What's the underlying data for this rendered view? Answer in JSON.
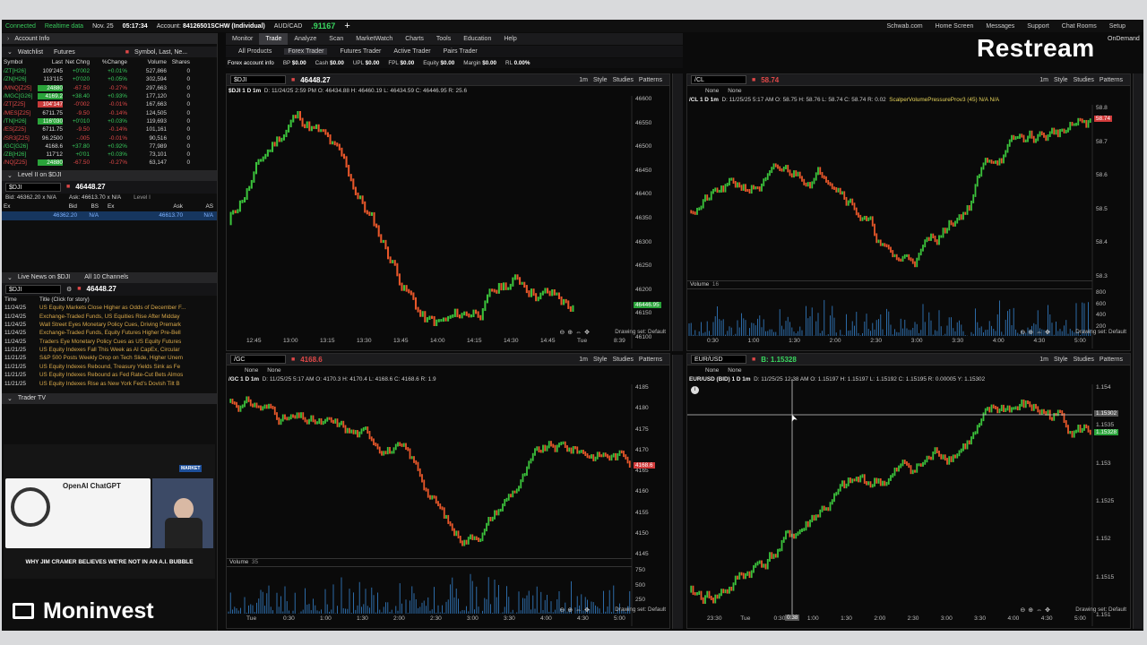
{
  "app": {
    "status": "Connected",
    "realtime": "Realtime data",
    "date": "Nov. 25",
    "time": "05:17:34",
    "account_label": "Account:",
    "account": "84126501SCHW (Individual)",
    "pair": "AUD/CAD",
    "pair_price": ".91167",
    "top_links": [
      "Schwab.com",
      "Home Screen",
      "Messages",
      "Support",
      "Chat Rooms",
      "Setup"
    ],
    "ondemand": "OnDemand"
  },
  "menu": {
    "items": [
      "Monitor",
      "Trade",
      "Analyze",
      "Scan",
      "MarketWatch",
      "Charts",
      "Tools",
      "Education",
      "Help"
    ],
    "active": "Trade"
  },
  "tools": [
    "All Products",
    "Forex Trader",
    "Futures Trader",
    "Active Trader",
    "Pairs Trader"
  ],
  "account_info": {
    "label": "Forex account info",
    "fields": [
      {
        "k": "BP",
        "v": "$0.00"
      },
      {
        "k": "Cash",
        "v": "$0.00"
      },
      {
        "k": "UPL",
        "v": "$0.00"
      },
      {
        "k": "FPL",
        "v": "$0.00"
      },
      {
        "k": "Equity",
        "v": "$0.00"
      },
      {
        "k": "Margin",
        "v": "$0.00"
      },
      {
        "k": "RL",
        "v": "0.00%"
      }
    ]
  },
  "left": {
    "account_info": "Account Info",
    "watchlist_label": "Watchlist",
    "watchlist_name": "Futures",
    "symbol_placeholder": "Symbol, Last, Ne...",
    "columns": [
      "Symbol",
      "Last",
      "Net Chng",
      "%Change",
      "Volume",
      "Shares"
    ],
    "rows": [
      {
        "sym": "/ZT[H26]",
        "last": "109'245",
        "chg": "+0'002",
        "pct": "+0.01%",
        "vol": "527,866",
        "sh": "0",
        "dir": "up",
        "hl": ""
      },
      {
        "sym": "/ZN[H26]",
        "last": "113'115",
        "chg": "+0'020",
        "pct": "+0.05%",
        "vol": "302,594",
        "sh": "0",
        "dir": "up",
        "hl": ""
      },
      {
        "sym": "/MNQ[Z25]",
        "last": "24880",
        "chg": "-67.50",
        "pct": "-0.27%",
        "vol": "297,663",
        "sh": "0",
        "dir": "dn",
        "hl": "g"
      },
      {
        "sym": "/MGC[G26]",
        "last": "4169.2",
        "chg": "+38.40",
        "pct": "+0.93%",
        "vol": "177,120",
        "sh": "0",
        "dir": "up",
        "hl": "g"
      },
      {
        "sym": "/ZT[Z25]",
        "last": "104'147",
        "chg": "-0'002",
        "pct": "-0.01%",
        "vol": "167,663",
        "sh": "0",
        "dir": "dn",
        "hl": "r"
      },
      {
        "sym": "/MES[Z25]",
        "last": "6711.75",
        "chg": "-9.50",
        "pct": "-0.14%",
        "vol": "124,505",
        "sh": "0",
        "dir": "dn",
        "hl": ""
      },
      {
        "sym": "/TN[H26]",
        "last": "116'030",
        "chg": "+0'010",
        "pct": "+0.03%",
        "vol": "119,693",
        "sh": "0",
        "dir": "up",
        "hl": "g"
      },
      {
        "sym": "/ES[Z25]",
        "last": "6711.75",
        "chg": "-9.50",
        "pct": "-0.14%",
        "vol": "101,161",
        "sh": "0",
        "dir": "dn",
        "hl": ""
      },
      {
        "sym": "/SR3[Z25]",
        "last": "96.2500",
        "chg": "-.005",
        "pct": "-0.01%",
        "vol": "90,516",
        "sh": "0",
        "dir": "dn",
        "hl": ""
      },
      {
        "sym": "/GC[G26]",
        "last": "4168.6",
        "chg": "+37.80",
        "pct": "+0.92%",
        "vol": "77,989",
        "sh": "0",
        "dir": "up",
        "hl": ""
      },
      {
        "sym": "/ZB[H26]",
        "last": "117'12",
        "chg": "+0'01",
        "pct": "+0.03%",
        "vol": "73,101",
        "sh": "0",
        "dir": "up",
        "hl": ""
      },
      {
        "sym": "/NQ[Z25]",
        "last": "24880",
        "chg": "-67.50",
        "pct": "-0.27%",
        "vol": "63,147",
        "sh": "0",
        "dir": "dn",
        "hl": "g"
      }
    ],
    "level2_title": "Level II on $DJI",
    "level2_symbol": "$DJI",
    "level2_price": "46448.27",
    "level2_bid": "Bid: 46362.20 x N/A",
    "level2_ask": "Ask: 46613.70 x N/A",
    "level2_label": "Level I",
    "level2_cols": [
      "Ex",
      "Bid",
      "BS",
      "Ex",
      "Ask",
      "AS"
    ],
    "level2_row": {
      "bid": "46362.20",
      "bs": "N/A",
      "ask": "46613.70",
      "as": "N/A"
    },
    "news_title": "Live News on $DJI",
    "news_channels": "All 10 Channels",
    "news_symbol": "$DJI",
    "news_price": "46448.27",
    "news_cols": [
      "Time",
      "Title (Click for story)"
    ],
    "news": [
      {
        "d": "11/24/25",
        "t": "US Equity Markets Close Higher as Odds of December F..."
      },
      {
        "d": "11/24/25",
        "t": "Exchange-Traded Funds, US Equities Rise After Midday"
      },
      {
        "d": "11/24/25",
        "t": "Wall Street Eyes Monetary Policy Cues, Driving Premark"
      },
      {
        "d": "11/24/25",
        "t": "Exchange-Traded Funds, Equity Futures Higher Pre-Bell"
      },
      {
        "d": "11/24/25",
        "t": "Traders Eye Monetary Policy Cues as US Equity Futures"
      },
      {
        "d": "11/21/25",
        "t": "US Equity Indexes Fall This Week as AI CapEx, Circular"
      },
      {
        "d": "11/21/25",
        "t": "S&P 500 Posts Weekly Drop on Tech Slide, Higher Unem"
      },
      {
        "d": "11/21/25",
        "t": "US Equity Indexes Rebound, Treasury Yields Sink as Fe"
      },
      {
        "d": "11/21/25",
        "t": "US Equity Indexes Rebound as Fed Rate-Cut Bets Almos"
      },
      {
        "d": "11/21/25",
        "t": "US Equity Indexes Rise as New York Fed's Dovish Tilt B"
      }
    ],
    "trader_tv": "Trader TV",
    "video_title": "OpenAI ChatGPT",
    "video_caption": "WHY JIM CRAMER BELIEVES WE'RE NOT IN AN A.I. BUBBLE",
    "video_badge": "MARKET"
  },
  "branding": {
    "restream": "Restream",
    "moninvest": "Moninvest"
  },
  "charts": [
    {
      "id": "dji",
      "symbol": "$DJI",
      "price": "46448.27",
      "header": "$DJI 1 D 1m",
      "ohlc": "D: 11/24/25 2:59 PM  O: 46434.88  H: 46460.19  L: 46434.59  C: 46446.95  R: 25.6",
      "last_tag": "46446.95",
      "yticks": [
        "46600",
        "46550",
        "46500",
        "46450",
        "46400",
        "46350",
        "46300",
        "46250",
        "46200",
        "46150",
        "46100"
      ],
      "xticks": [
        "12:45",
        "13:00",
        "13:15",
        "13:30",
        "13:45",
        "14:00",
        "14:15",
        "14:30",
        "14:45",
        "Tue",
        "8:39"
      ],
      "drawing": "Drawing set: Default"
    },
    {
      "id": "cl",
      "symbol": "/CL",
      "price": "58.74",
      "header": "/CL 1 D 1m",
      "ohlc": "D: 11/25/25 5:17 AM  O: 58.75  H: 58.76  L: 58.74  C: 58.74  R: 0.02",
      "study": "ScalperVolumePressureProv3 (45)  N/A  N/A",
      "last_tag": "58.74",
      "yticks": [
        "58.8",
        "58.7",
        "58.6",
        "58.5",
        "58.4",
        "58.3"
      ],
      "vol_label": "Volume",
      "vol_val": "16",
      "vol_ticks": [
        "800",
        "600",
        "400",
        "200"
      ],
      "xticks": [
        "0:30",
        "1:00",
        "1:30",
        "2:00",
        "2:30",
        "3:00",
        "3:30",
        "4:00",
        "4:30",
        "5:00"
      ],
      "drawing": "Drawing set: Default"
    },
    {
      "id": "gc",
      "symbol": "/GC",
      "price": "4168.6",
      "header": "/GC 1 D 1m",
      "ohlc": "D: 11/25/25 5:17 AM  O: 4170.3  H: 4170.4  L: 4168.6  C: 4168.6  R: 1.9",
      "last_tag": "4168.6",
      "yticks": [
        "4185",
        "4180",
        "4175",
        "4170",
        "4165",
        "4160",
        "4155",
        "4150",
        "4145"
      ],
      "vol_label": "Volume",
      "vol_val": "35",
      "vol_ticks": [
        "750",
        "500",
        "250"
      ],
      "xticks": [
        "Tue",
        "0:30",
        "1:00",
        "1:30",
        "2:00",
        "2:30",
        "3:00",
        "3:30",
        "4:00",
        "4:30",
        "5:00"
      ],
      "drawing": "Drawing set: Default"
    },
    {
      "id": "eur",
      "symbol": "EUR/USD",
      "price": "B: 1.15328",
      "header": "EUR/USD (BID) 1 D 1m",
      "ohlc": "D: 11/25/25 12:38 AM  O: 1.15197  H: 1.15197  L: 1.15192  C: 1.15195  R: 0.00005  Y: 1.15302",
      "last_tag": "1.15328",
      "cross_tag": "1.15302",
      "cross_time": "0:38",
      "yticks": [
        "1.154",
        "1.1535",
        "1.153",
        "1.1525",
        "1.152",
        "1.1515",
        "1.151"
      ],
      "xticks": [
        "23:30",
        "Tue",
        "0:30",
        "1:00",
        "1:30",
        "2:00",
        "2:30",
        "3:00",
        "3:30",
        "4:00",
        "4:30",
        "5:00"
      ],
      "drawing": "Drawing set: Default"
    }
  ],
  "chart_toolbar": [
    "1m",
    "Style",
    "Studies",
    "Patterns"
  ],
  "pos_none": "None"
}
